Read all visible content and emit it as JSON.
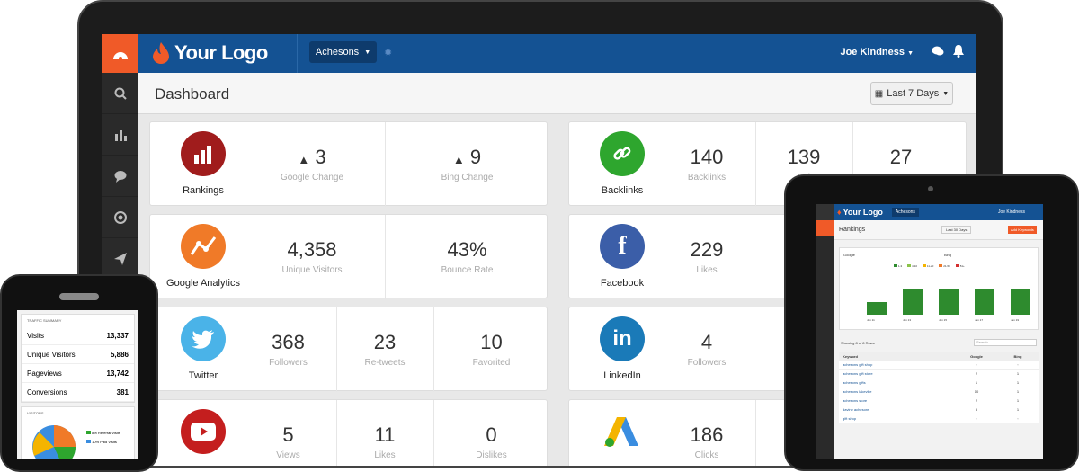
{
  "app": {
    "brand": "Your Logo",
    "account": "Achesons",
    "user": "Joe Kindness"
  },
  "header": {
    "title": "Dashboard",
    "range": "Last 7 Days"
  },
  "colors": {
    "accent": "#f05a28",
    "topbar": "#145293",
    "green": "#3a9b3a"
  },
  "cards": {
    "rankings": {
      "name": "Rankings",
      "v1": "3",
      "l1": "Google Change",
      "v2": "9",
      "l2": "Bing Change"
    },
    "backlinks": {
      "name": "Backlinks",
      "v1": "140",
      "l1": "Backlinks",
      "v2": "139",
      "l2": "Fol",
      "v3": "27"
    },
    "analytics": {
      "name": "Google Analytics",
      "v1": "4,358",
      "l1": "Unique Visitors",
      "v2": "43%",
      "l2": "Bounce Rate"
    },
    "facebook": {
      "name": "Facebook",
      "v1": "229",
      "l1": "Likes"
    },
    "twitter": {
      "name": "Twitter",
      "v1": "368",
      "l1": "Followers",
      "v2": "23",
      "l2": "Re-tweets",
      "v3": "10",
      "l3": "Favorited"
    },
    "linkedin": {
      "name": "LinkedIn",
      "v1": "4",
      "l1": "Followers"
    },
    "youtube": {
      "v1": "5",
      "l1": "Views",
      "v2": "11",
      "l2": "Likes",
      "v3": "0",
      "l3": "Dislikes"
    },
    "adwords": {
      "v1": "186",
      "l1": "Clicks",
      "v2": "$"
    }
  },
  "tablet": {
    "brand": "Your Logo",
    "account": "Achesons",
    "user": "Joe Kindness",
    "title": "Rankings",
    "range": "Last 30 Days",
    "add": "Add Keywords",
    "engine1": "Google",
    "engine2": "Bing",
    "legend": [
      "1-3",
      "4-10",
      "11-20",
      "21-50",
      "51+"
    ],
    "chart_labels": [
      "Jan 11",
      "Jan 13",
      "Jan 15",
      "Jan 17",
      "Jan 19"
    ],
    "showing": "Showing 8 of 8 Rows",
    "search": "Search...",
    "cols": [
      "Keyword",
      "Google",
      "Bing"
    ],
    "rows": [
      [
        "achesons gift shop",
        "◦",
        "◦"
      ],
      [
        "achesons gift store",
        "2",
        "1"
      ],
      [
        "achesons gifts",
        "1",
        "1"
      ],
      [
        "achesons lakeville",
        "10",
        "1"
      ],
      [
        "achesons store",
        "2",
        "1"
      ],
      [
        "davine achesons",
        "5",
        "1"
      ],
      [
        "gift shop",
        "◦",
        "◦"
      ]
    ]
  },
  "phone": {
    "section1": "TRAFFIC SUMMARY",
    "rows": [
      [
        "Visits",
        "13,337"
      ],
      [
        "Unique Visitors",
        "5,886"
      ],
      [
        "Pageviews",
        "13,742"
      ],
      [
        "Conversions",
        "381"
      ]
    ],
    "section2": "VISITORS",
    "legend": [
      "8% Referral Visits",
      "10% Paid Visits"
    ]
  }
}
